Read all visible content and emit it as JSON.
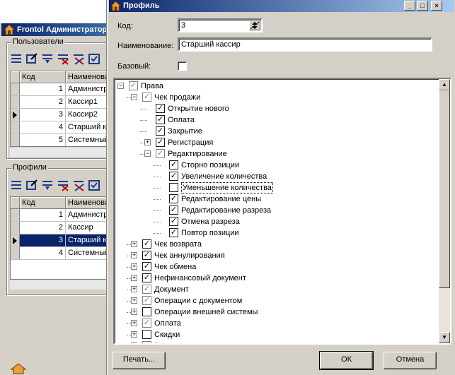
{
  "background_window": {
    "title": "Frontol Администратор",
    "users_group": {
      "title": "Пользователи",
      "columns": [
        "Код",
        "Наименова"
      ],
      "rows": [
        {
          "code": "1",
          "name": "Администр"
        },
        {
          "code": "2",
          "name": "Кассир1"
        },
        {
          "code": "3",
          "name": "Кассир2"
        },
        {
          "code": "4",
          "name": "Старший ка"
        },
        {
          "code": "5",
          "name": "Системный"
        }
      ],
      "current_row": 2
    },
    "profiles_group": {
      "title": "Профили",
      "columns": [
        "Код",
        "Наименова"
      ],
      "rows": [
        {
          "code": "1",
          "name": "Администр"
        },
        {
          "code": "2",
          "name": "Кассир"
        },
        {
          "code": "3",
          "name": "Старший ка"
        },
        {
          "code": "4",
          "name": "Системный"
        }
      ],
      "selected_row": 2
    }
  },
  "dialog": {
    "title": "Профиль",
    "caption_buttons": {
      "minimize": "_",
      "maximize": "□",
      "close": "×"
    },
    "code_label": "Код:",
    "code_value": "3",
    "name_label": "Наименование:",
    "name_value": "Старший кассир",
    "base_label": "Базовый:",
    "base_checked": false,
    "tree": [
      {
        "label": "Права",
        "state": "gray",
        "expander": "-",
        "level": 0
      },
      {
        "label": "Чек продажи",
        "state": "gray",
        "expander": "-",
        "level": 1
      },
      {
        "label": "Открытие нового",
        "state": "checked",
        "expander": "",
        "level": 2
      },
      {
        "label": "Оплата",
        "state": "checked",
        "expander": "",
        "level": 2
      },
      {
        "label": "Закрытие",
        "state": "checked",
        "expander": "",
        "level": 2
      },
      {
        "label": "Регистрация",
        "state": "checked",
        "expander": "+",
        "level": 2
      },
      {
        "label": "Редактирование",
        "state": "gray",
        "expander": "-",
        "level": 2
      },
      {
        "label": "Сторно позиции",
        "state": "checked",
        "expander": "",
        "level": 3
      },
      {
        "label": "Увеличение количества",
        "state": "checked",
        "expander": "",
        "level": 3
      },
      {
        "label": "Уменьшение количества",
        "state": "unchecked",
        "expander": "",
        "level": 3,
        "focused": true
      },
      {
        "label": "Редактирование цены",
        "state": "checked",
        "expander": "",
        "level": 3
      },
      {
        "label": "Редактирование разреза",
        "state": "checked",
        "expander": "",
        "level": 3
      },
      {
        "label": "Отмена разреза",
        "state": "checked",
        "expander": "",
        "level": 3
      },
      {
        "label": "Повтор позиции",
        "state": "checked",
        "expander": "",
        "level": 3
      },
      {
        "label": "Чек возврата",
        "state": "checked",
        "expander": "+",
        "level": 1
      },
      {
        "label": "Чек аннулирования",
        "state": "checked",
        "expander": "+",
        "level": 1
      },
      {
        "label": "Чек обмена",
        "state": "checked",
        "expander": "+",
        "level": 1
      },
      {
        "label": "Нефинансовый документ",
        "state": "checked",
        "expander": "+",
        "level": 1
      },
      {
        "label": "Документ",
        "state": "gray",
        "expander": "+",
        "level": 1
      },
      {
        "label": "Операции с документом",
        "state": "gray",
        "expander": "+",
        "level": 1
      },
      {
        "label": "Операции внешней системы",
        "state": "unchecked",
        "expander": "+",
        "level": 1
      },
      {
        "label": "Оплата",
        "state": "gray",
        "expander": "+",
        "level": 1
      },
      {
        "label": "Скидки",
        "state": "unchecked",
        "expander": "+",
        "level": 1
      },
      {
        "label": "Карта клиента",
        "state": "gray",
        "expander": "+",
        "level": 1
      }
    ],
    "print_button": "Печать...",
    "ok_button": "ОК",
    "cancel_button": "Отмена"
  },
  "colors": {
    "title_active": "#0a246a",
    "title_gradient_end": "#a6caf0",
    "selection": "#0a246a",
    "face": "#d4d0c8"
  }
}
